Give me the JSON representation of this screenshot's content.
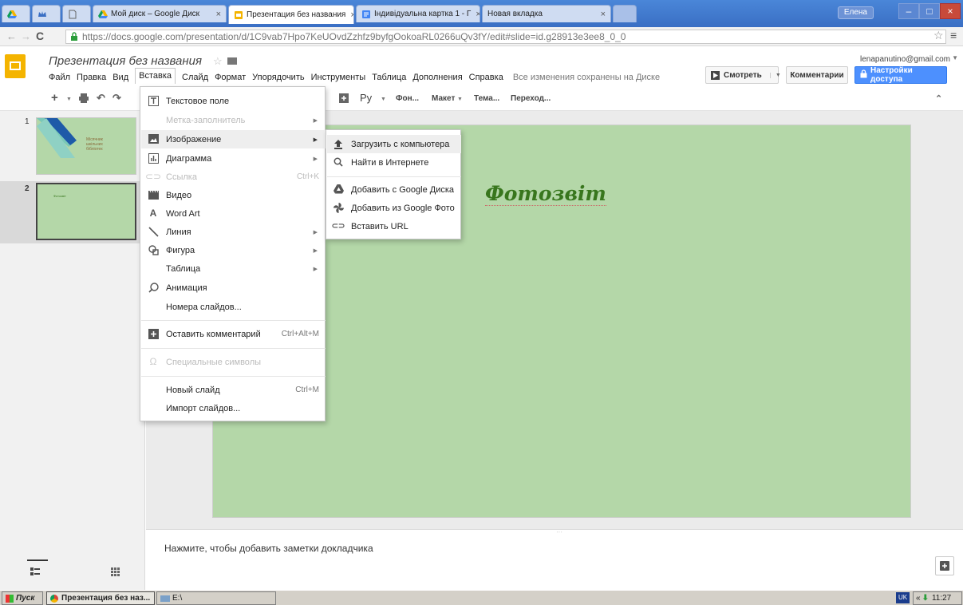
{
  "browser": {
    "tabs": [
      {
        "label": ""
      },
      {
        "label": ""
      },
      {
        "label": ""
      },
      {
        "label": "Мой диск – Google Диск"
      },
      {
        "label": "Презентация без названия"
      },
      {
        "label": "Індивідуальна картка 1 - Г"
      },
      {
        "label": "Новая вкладка"
      }
    ],
    "user": "Елена",
    "url": "https://docs.google.com/presentation/d/1C9vab7Hpo7KeUOvdZzhfz9byfgOokoaRL0266uQv3fY/edit#slide=id.g28913e3ee8_0_0"
  },
  "app": {
    "title": "Презентация без названия",
    "account": "lenapanutino@gmail.com",
    "menu": [
      "Файл",
      "Правка",
      "Вид",
      "Вставка",
      "Слайд",
      "Формат",
      "Упорядочить",
      "Инструменты",
      "Таблица",
      "Дополнения",
      "Справка"
    ],
    "save_status": "Все изменения сохранены на Диске",
    "present_label": "Смотреть",
    "comments_label": "Комментарии",
    "share_label": "Настройки доступа"
  },
  "toolbar": {
    "font": "Ру",
    "background": "Фон...",
    "layout": "Макет",
    "theme": "Тема...",
    "transition": "Переход..."
  },
  "slides": [
    {
      "number": "1",
      "lines": [
        "Місячник",
        "шкільних",
        "бібліотек"
      ]
    },
    {
      "number": "2",
      "title": "Фотозвіт"
    }
  ],
  "canvas": {
    "title": "Фотозвіт"
  },
  "notes": {
    "placeholder": "Нажмите, чтобы добавить заметки докладчика"
  },
  "insert_menu": {
    "items": [
      {
        "label": "Текстовое поле",
        "icon": "text-box-icon",
        "disabled": false
      },
      {
        "label": "Метка-заполнитель",
        "disabled": true,
        "submenu": true
      },
      {
        "label": "Изображение",
        "icon": "image-icon",
        "disabled": false,
        "submenu": true,
        "highlighted": true
      },
      {
        "label": "Диаграмма",
        "icon": "chart-icon",
        "disabled": false,
        "submenu": true
      },
      {
        "label": "Ссылка",
        "icon": "link-icon",
        "disabled": true,
        "shortcut": "Ctrl+K"
      },
      {
        "label": "Видео",
        "icon": "video-icon",
        "disabled": false
      },
      {
        "label": "Word Art",
        "icon": "word-art-icon",
        "disabled": false
      },
      {
        "label": "Линия",
        "icon": "line-icon",
        "disabled": false,
        "submenu": true
      },
      {
        "label": "Фигура",
        "icon": "shape-icon",
        "disabled": false,
        "submenu": true
      },
      {
        "label": "Таблица",
        "disabled": false,
        "submenu": true
      },
      {
        "label": "Анимация",
        "icon": "animation-icon",
        "disabled": false
      },
      {
        "label": "Номера слайдов...",
        "disabled": false
      },
      {
        "label": "Оставить комментарий",
        "icon": "comment-icon",
        "disabled": false,
        "shortcut": "Ctrl+Alt+M"
      },
      {
        "label": "Специальные символы",
        "icon": "omega-icon",
        "disabled": true
      },
      {
        "label": "Новый слайд",
        "disabled": false,
        "shortcut": "Ctrl+M"
      },
      {
        "label": "Импорт слайдов...",
        "disabled": false
      }
    ]
  },
  "image_submenu": {
    "items": [
      {
        "label": "Загрузить с компьютера",
        "icon": "upload-icon"
      },
      {
        "label": "Найти в Интернете",
        "icon": "search-icon"
      },
      {
        "label": "Добавить с Google Диска",
        "icon": "drive-icon"
      },
      {
        "label": "Добавить из Google Фото",
        "icon": "photos-icon"
      },
      {
        "label": "Вставить URL",
        "icon": "link-icon"
      }
    ]
  },
  "taskbar": {
    "start": "Пуск",
    "window1": "Презентация без наз...",
    "window2": "E:\\",
    "lang": "UK",
    "clock": "11:27"
  },
  "colors": {
    "accent": "#4d90fe",
    "slide_bg": "#b4d7a8",
    "title": "#38761d",
    "logo": "#f4b400"
  }
}
